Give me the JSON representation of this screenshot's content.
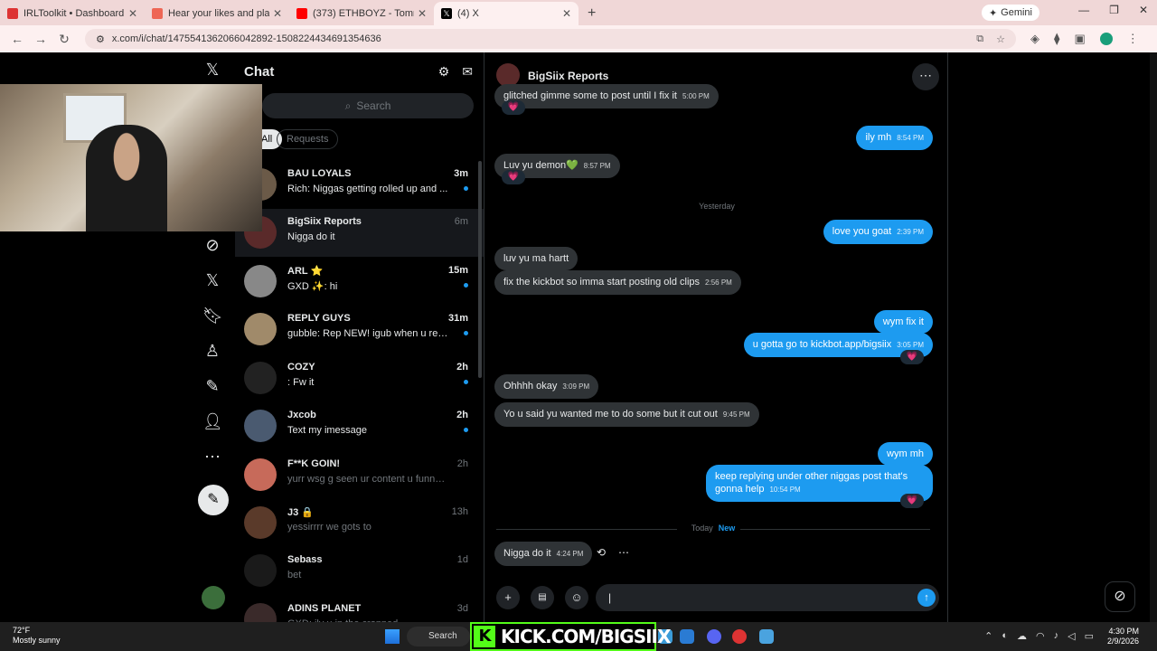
{
  "browser": {
    "tabs": [
      {
        "title": "IRLToolkit • Dashboard",
        "fav": "#d33"
      },
      {
        "title": "Hear your likes and playlists, an",
        "fav": "#e65"
      },
      {
        "title": "(373) ETHBOYZ - Tommy G - Yo",
        "fav": "#f00"
      },
      {
        "title": "(4) X",
        "fav": "#000"
      }
    ],
    "gemini": "Gemini",
    "url": "x.com/i/chat/1475541362066042892-1508224434691354636"
  },
  "sidebar": {
    "title": "Chat",
    "search_placeholder": "Search",
    "filters": [
      "All",
      "Requests"
    ]
  },
  "conversations": [
    {
      "name": "BAU LOYALS",
      "time": "3m",
      "preview": "Rich: Niggas getting rolled up and ...",
      "unread": true,
      "selected": false,
      "color": "#6b5a48"
    },
    {
      "name": "BigSiix Reports",
      "time": "6m",
      "preview": "Nigga do it",
      "unread": false,
      "selected": true,
      "color": "#5a2a2a"
    },
    {
      "name": "ARL ⭐",
      "time": "15m",
      "preview": "GXD ✨: hi",
      "unread": true,
      "selected": false,
      "color": "#888"
    },
    {
      "name": "REPLY GUYS",
      "time": "31m",
      "preview": "gubble: Rep NEW! igub when u rep...",
      "unread": true,
      "selected": false,
      "color": "#a08a6a"
    },
    {
      "name": "COZY",
      "time": "2h",
      "preview": ": Fw it",
      "unread": true,
      "selected": false,
      "color": "#222"
    },
    {
      "name": "Jxcob",
      "time": "2h",
      "preview": "Text my imessage",
      "unread": true,
      "selected": false,
      "color": "#4a5a70"
    },
    {
      "name": "F**K GOIN!",
      "time": "2h",
      "preview": "yurr wsg g seen ur content u funnny asf l...",
      "unread": false,
      "selected": false,
      "color": "#c76a5a"
    },
    {
      "name": "J3 🔒",
      "time": "13h",
      "preview": "yessirrrr we gots to",
      "unread": false,
      "selected": false,
      "color": "#5a3a2a"
    },
    {
      "name": "Sebass",
      "time": "1d",
      "preview": "bet",
      "unread": false,
      "selected": false,
      "color": "#1a1a1a"
    },
    {
      "name": "ADINS PLANET",
      "time": "3d",
      "preview": "GXD: ily u in the cropped",
      "unread": false,
      "selected": false,
      "color": "#3a2a2a"
    }
  ],
  "thread": {
    "title": "BigSiix Reports",
    "day_yesterday": "Yesterday",
    "day_today": "Today",
    "new_label": "New",
    "compose_placeholder": "",
    "messages": [
      {
        "dir": "in",
        "text": "glitched gimme some to post until I fix it",
        "time": "5:00 PM",
        "react": "💗"
      },
      {
        "dir": "out",
        "text": "ily mh",
        "time": "8:54 PM"
      },
      {
        "dir": "in",
        "text": "Luv yu demon💚",
        "time": "8:57 PM",
        "react": "💗"
      },
      {
        "dir": "out",
        "text": "love you goat",
        "time": "2:39 PM"
      },
      {
        "dir": "in",
        "text": "luv yu ma hartt",
        "time": ""
      },
      {
        "dir": "in",
        "text": "fix the kickbot so imma start posting old clips",
        "time": "2:56 PM"
      },
      {
        "dir": "out",
        "text": "wym fix it",
        "time": ""
      },
      {
        "dir": "out",
        "text": "u gotta go to kickbot.app/bigsiix",
        "time": "3:05 PM",
        "react": "💗"
      },
      {
        "dir": "in",
        "text": "Ohhhh okay",
        "time": "3:09 PM"
      },
      {
        "dir": "in",
        "text": "Yo u said yu wanted me to do some but it cut out",
        "time": "9:45 PM"
      },
      {
        "dir": "out",
        "text": "wym mh",
        "time": ""
      },
      {
        "dir": "out",
        "text": "keep replying under other niggas post that's gonna help",
        "time": "10:54 PM",
        "react": "💗"
      },
      {
        "dir": "in",
        "text": "Nigga do it",
        "time": "4:24 PM"
      }
    ]
  },
  "taskbar": {
    "temp": "72°F",
    "weather": "Mostly sunny",
    "search": "Search",
    "overlay": "KICK.COM/BIGSIIX",
    "time": "4:30 PM",
    "date": "2/9/2026"
  }
}
